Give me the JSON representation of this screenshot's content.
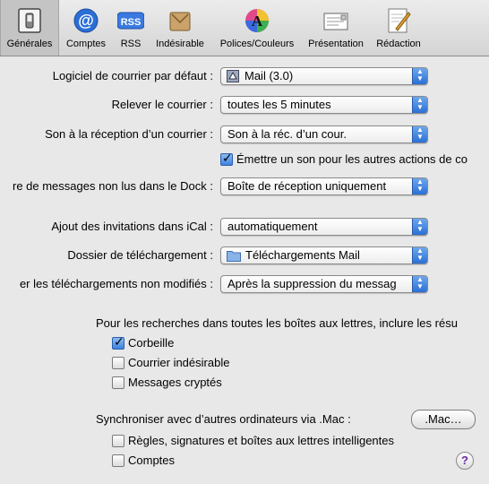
{
  "toolbar": {
    "items": [
      {
        "label": "Générales",
        "icon": "switch-icon"
      },
      {
        "label": "Comptes",
        "icon": "at-icon"
      },
      {
        "label": "RSS",
        "icon": "rss-icon"
      },
      {
        "label": "Indésirable",
        "icon": "junk-icon"
      },
      {
        "label": "Polices/Couleurs",
        "icon": "fonts-colors-icon"
      },
      {
        "label": "Présentation",
        "icon": "presentation-icon"
      },
      {
        "label": "Rédaction",
        "icon": "composing-icon"
      }
    ],
    "rss_text": "RSS",
    "at_text": "@",
    "font_text": "A",
    "selected": "Générales"
  },
  "rows": {
    "default_mail": {
      "label": "Logiciel de courrier par défaut :",
      "value": "Mail (3.0)"
    },
    "check_mail": {
      "label": "Relever le courrier :",
      "value": "toutes les 5 minutes"
    },
    "new_mail_sound": {
      "label": "Son à la réception d’un courrier :",
      "value": "Son à la réc. d’un cour."
    },
    "dock_unread": {
      "label": "re de messages non lus dans le Dock :",
      "value": "Boîte de réception uniquement"
    },
    "ical": {
      "label": "Ajout des invitations dans iCal :",
      "value": "automatiquement"
    },
    "downloads_folder": {
      "label": "Dossier de téléchargement :",
      "value": "Téléchargements Mail"
    },
    "remove_downloads": {
      "label": "er les téléchargements non modifiés :",
      "value": "Après la suppression du messag"
    }
  },
  "sound_checkbox": {
    "label": "Émettre un son pour les autres actions de co",
    "checked": true
  },
  "search": {
    "heading": "Pour les recherches dans toutes les boîtes aux lettres, inclure les résu",
    "options": [
      {
        "label": "Corbeille",
        "checked": true
      },
      {
        "label": "Courrier indésirable",
        "checked": false
      },
      {
        "label": "Messages cryptés",
        "checked": false
      }
    ]
  },
  "sync": {
    "heading": "Synchroniser avec d’autres ordinateurs via .Mac :",
    "button": ".Mac…",
    "options": [
      {
        "label": "Règles, signatures et boîtes aux lettres intelligentes",
        "checked": false
      },
      {
        "label": "Comptes",
        "checked": false
      }
    ]
  },
  "help": "?",
  "colors": {
    "accent": "#3d82e0",
    "background": "#e8e8e8"
  }
}
